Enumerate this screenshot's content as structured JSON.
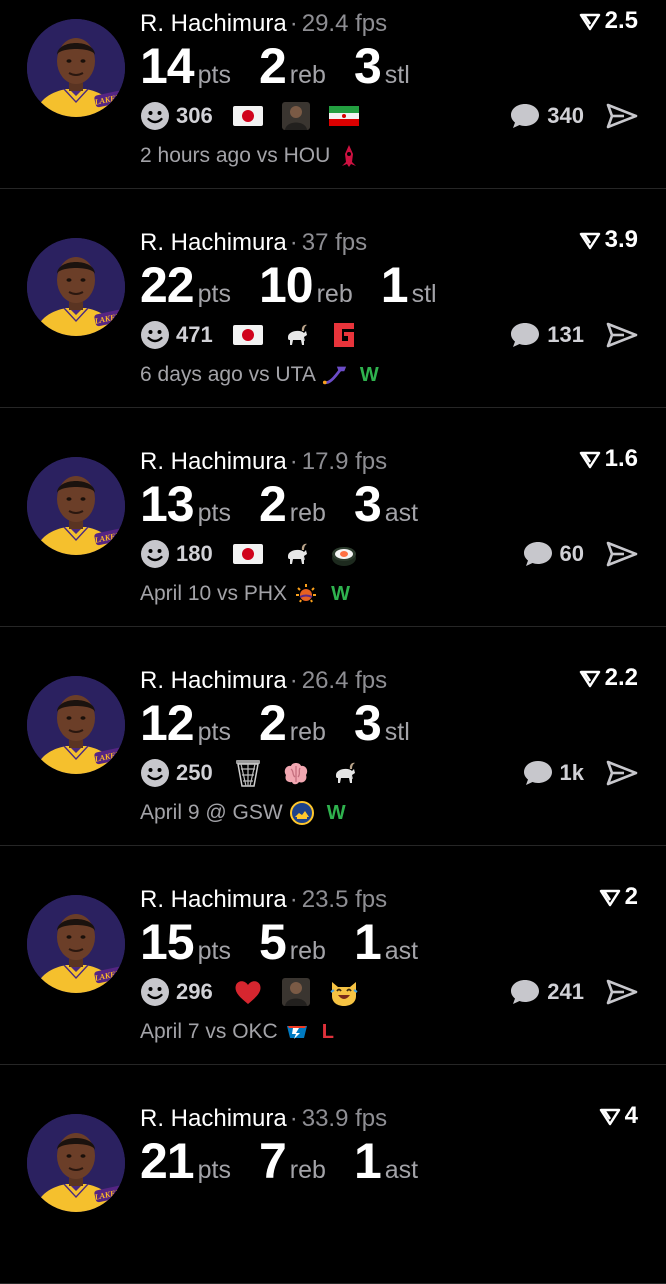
{
  "colors": {
    "background": "#000000",
    "text": "#ffffff",
    "muted": "#a3a3a8",
    "win": "#2fb24e",
    "loss": "#e0313b",
    "lakers_purple": "#552583",
    "lakers_gold": "#fdb927"
  },
  "feed": [
    {
      "player": "R. Hachimura",
      "fps": "29.4 fps",
      "score": "2.5",
      "stats": [
        {
          "value": "14",
          "unit": "pts"
        },
        {
          "value": "2",
          "unit": "reb"
        },
        {
          "value": "3",
          "unit": "stl"
        }
      ],
      "reaction_count": "306",
      "emojis": [
        "japan-flag-emoji",
        "person-photo-emoji",
        "iran-flag-emoji"
      ],
      "comment_count": "340",
      "time": "2 hours ago",
      "opponent": "vs HOU",
      "team_logo": "rockets-logo-icon",
      "result": ""
    },
    {
      "player": "R. Hachimura",
      "fps": "37 fps",
      "score": "3.9",
      "stats": [
        {
          "value": "22",
          "unit": "pts"
        },
        {
          "value": "10",
          "unit": "reb"
        },
        {
          "value": "1",
          "unit": "stl"
        }
      ],
      "reaction_count": "471",
      "emojis": [
        "japan-flag-emoji",
        "goat-emoji",
        "red-logo-emoji"
      ],
      "comment_count": "131",
      "time": "6 days ago",
      "opponent": "vs UTA",
      "team_logo": "jazz-logo-icon",
      "result": "W"
    },
    {
      "player": "R. Hachimura",
      "fps": "17.9 fps",
      "score": "1.6",
      "stats": [
        {
          "value": "13",
          "unit": "pts"
        },
        {
          "value": "2",
          "unit": "reb"
        },
        {
          "value": "3",
          "unit": "ast"
        }
      ],
      "reaction_count": "180",
      "emojis": [
        "japan-flag-emoji",
        "goat-emoji",
        "sushi-emoji"
      ],
      "comment_count": "60",
      "time": "April 10",
      "opponent": "vs PHX",
      "team_logo": "suns-logo-icon",
      "result": "W"
    },
    {
      "player": "R. Hachimura",
      "fps": "26.4 fps",
      "score": "2.2",
      "stats": [
        {
          "value": "12",
          "unit": "pts"
        },
        {
          "value": "2",
          "unit": "reb"
        },
        {
          "value": "3",
          "unit": "stl"
        }
      ],
      "reaction_count": "250",
      "emojis": [
        "basketball-hoop-emoji",
        "brain-emoji",
        "goat-emoji"
      ],
      "comment_count": "1k",
      "time": "April 9",
      "opponent": "@ GSW",
      "team_logo": "warriors-logo-icon",
      "result": "W"
    },
    {
      "player": "R. Hachimura",
      "fps": "23.5 fps",
      "score": "2",
      "stats": [
        {
          "value": "15",
          "unit": "pts"
        },
        {
          "value": "5",
          "unit": "reb"
        },
        {
          "value": "1",
          "unit": "ast"
        }
      ],
      "reaction_count": "296",
      "emojis": [
        "red-heart-emoji",
        "person-photo-emoji",
        "laughing-cat-emoji"
      ],
      "comment_count": "241",
      "time": "April 7",
      "opponent": "vs OKC",
      "team_logo": "thunder-logo-icon",
      "result": "L"
    },
    {
      "player": "R. Hachimura",
      "fps": "33.9 fps",
      "score": "4",
      "stats": [
        {
          "value": "21",
          "unit": "pts"
        },
        {
          "value": "7",
          "unit": "reb"
        },
        {
          "value": "1",
          "unit": "ast"
        }
      ],
      "reaction_count": "",
      "emojis": [],
      "comment_count": "",
      "time": "",
      "opponent": "",
      "team_logo": "",
      "result": ""
    }
  ]
}
